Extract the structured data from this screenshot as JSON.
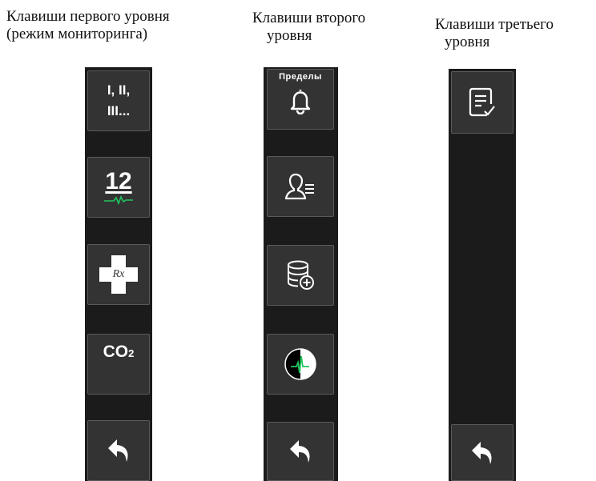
{
  "colors": {
    "strip_bg": "#1b1b1b",
    "key_bg": "#333333",
    "ecg_green": "#22c55e"
  },
  "level1": {
    "caption_line1": "Клавиши первого уровня",
    "caption_line2": "(режим мониторинга)",
    "keys": [
      {
        "icon": "leads-text",
        "label": "I, II,",
        "label2": "III..."
      },
      {
        "icon": "ecg-12-lead-icon",
        "label": "12"
      },
      {
        "icon": "medical-cross-rx-icon",
        "label": "Rx"
      },
      {
        "icon": "co2-text",
        "label": "CO",
        "sub": "2"
      },
      {
        "icon": "back-arrow-icon"
      }
    ]
  },
  "level2": {
    "caption_line1": "Клавиши второго",
    "caption_line2": "уровня",
    "keys": [
      {
        "icon": "bell-icon",
        "label": "Пределы"
      },
      {
        "icon": "patient-info-icon"
      },
      {
        "icon": "database-add-icon"
      },
      {
        "icon": "ecg-circle-icon"
      },
      {
        "icon": "back-arrow-icon"
      }
    ]
  },
  "level3": {
    "caption_line1": "Клавиши третьего",
    "caption_line2": "уровня",
    "keys": [
      {
        "icon": "report-check-icon"
      },
      {
        "icon": "back-arrow-icon"
      }
    ]
  }
}
